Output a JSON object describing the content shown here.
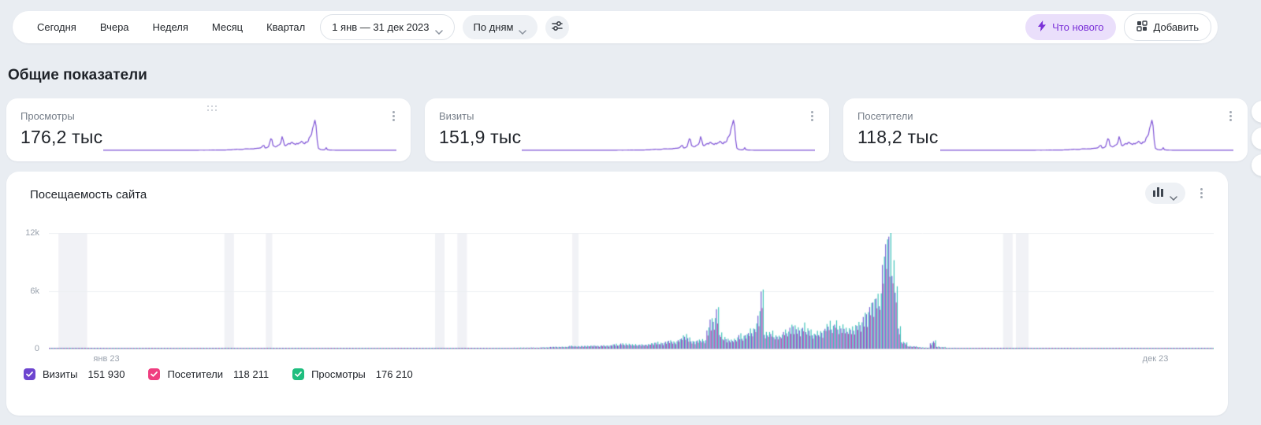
{
  "toolbar": {
    "period_buttons": [
      "Сегодня",
      "Вчера",
      "Неделя",
      "Месяц",
      "Квартал"
    ],
    "date_range": "1 янв — 31 дек 2023",
    "granularity": "По дням",
    "whats_new_label": "Что нового",
    "add_label": "Добавить",
    "accent_color": "#7b31d8"
  },
  "section_title": "Общие показатели",
  "cards": {
    "sparkline_color": "#7e52d6",
    "items": [
      {
        "label": "Просмотры",
        "value": "176,2 тыс"
      },
      {
        "label": "Визиты",
        "value": "151,9 тыс"
      },
      {
        "label": "Посетители",
        "value": "118,2 тыс"
      }
    ]
  },
  "chart": {
    "title": "Посещаемость сайта",
    "y_ticks": [
      "12k",
      "6k",
      "0"
    ],
    "x_ticks": [
      "янв 23",
      "дек 23"
    ],
    "legend": [
      {
        "label": "Визиты",
        "value": "151 930"
      },
      {
        "label": "Посетители",
        "value": "118 211"
      },
      {
        "label": "Просмотры",
        "value": "176 210"
      }
    ]
  },
  "chart_data": {
    "type": "bar",
    "title": "Посещаемость сайта",
    "days": 365,
    "x_range_labels": [
      "янв 23",
      "дек 23"
    ],
    "ylim": [
      0,
      12000
    ],
    "y_tick_values": [
      0,
      6000,
      12000
    ],
    "grid": true,
    "legend_position": "bottom",
    "series": [
      {
        "name": "Визиты",
        "total": 151930,
        "ratio_of_views": 0.862,
        "color": "#6f5cd1",
        "legend_color": "#6d45cf"
      },
      {
        "name": "Посетители",
        "total": 118211,
        "ratio_of_views": 0.671,
        "color": "#bd52ab",
        "legend_color": "#ef3e80"
      },
      {
        "name": "Просмотры",
        "total": 176210,
        "ratio_of_views": 1.0,
        "color": "#38c2b8",
        "legend_color": "#1fbe7f"
      }
    ],
    "views_envelope_points": [
      [
        0,
        25
      ],
      [
        45,
        30
      ],
      [
        95,
        45
      ],
      [
        140,
        70
      ],
      [
        152,
        110
      ],
      [
        160,
        200
      ],
      [
        166,
        330
      ],
      [
        172,
        300
      ],
      [
        178,
        480
      ],
      [
        184,
        420
      ],
      [
        190,
        620
      ],
      [
        196,
        800
      ],
      [
        199,
        1800
      ],
      [
        201,
        750
      ],
      [
        205,
        1000
      ],
      [
        209,
        4400
      ],
      [
        210,
        1600
      ],
      [
        213,
        1100
      ],
      [
        217,
        1500
      ],
      [
        220,
        2000
      ],
      [
        223,
        5200
      ],
      [
        224,
        1700
      ],
      [
        227,
        1500
      ],
      [
        231,
        2100
      ],
      [
        235,
        2400
      ],
      [
        239,
        1900
      ],
      [
        243,
        2300
      ],
      [
        246,
        2800
      ],
      [
        249,
        2100
      ],
      [
        252,
        2600
      ],
      [
        255,
        3300
      ],
      [
        257,
        4300
      ],
      [
        259,
        5800
      ],
      [
        261,
        8500
      ],
      [
        262,
        9800
      ],
      [
        263,
        10400
      ],
      [
        264,
        8300
      ],
      [
        265,
        5600
      ],
      [
        266,
        2300
      ],
      [
        267,
        800
      ],
      [
        269,
        350
      ],
      [
        272,
        180
      ],
      [
        275,
        130
      ],
      [
        277,
        950
      ],
      [
        278,
        250
      ],
      [
        281,
        100
      ],
      [
        286,
        60
      ],
      [
        295,
        45
      ],
      [
        320,
        40
      ],
      [
        345,
        45
      ],
      [
        364,
        35
      ]
    ],
    "holiday_bands_days": [
      [
        3,
        11
      ],
      [
        55,
        57
      ],
      [
        68,
        69
      ],
      [
        121,
        123
      ],
      [
        128,
        130
      ],
      [
        164,
        165
      ],
      [
        299,
        301
      ],
      [
        303,
        306
      ]
    ],
    "band_color": "#f1f2f6",
    "gridline_color": "#eef0f3",
    "baseline_color": "#d9dde3"
  }
}
